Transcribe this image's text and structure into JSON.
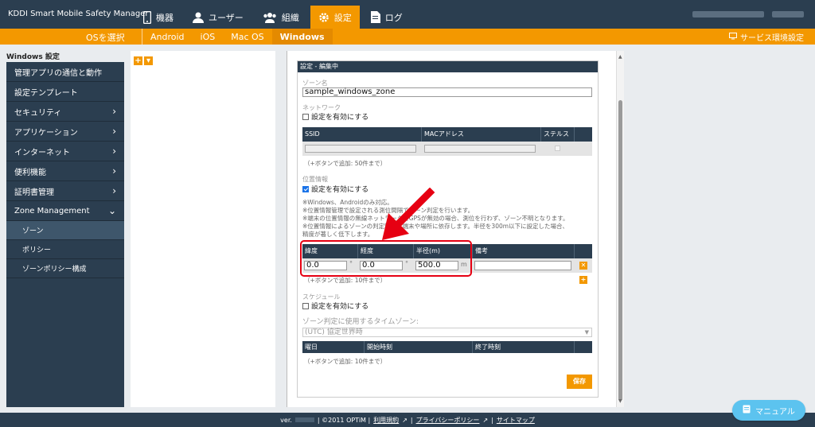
{
  "header": {
    "brand": "KDDI Smart Mobile Safety Manager",
    "nav": [
      {
        "label": "機器",
        "icon": "phone-icon"
      },
      {
        "label": "ユーザー",
        "icon": "user-icon"
      },
      {
        "label": "組織",
        "icon": "group-icon"
      },
      {
        "label": "設定",
        "icon": "gear-icon",
        "active": true
      },
      {
        "label": "ログ",
        "icon": "document-icon"
      }
    ]
  },
  "subbar": {
    "os_select": "OSを選択",
    "tabs": [
      "Android",
      "iOS",
      "Mac OS",
      "Windows"
    ],
    "active_tab": "Windows",
    "service_settings": "サービス環境設定"
  },
  "sidebar": {
    "title": "Windows 設定",
    "items": [
      {
        "label": "管理アプリの通信と動作",
        "chevron": ""
      },
      {
        "label": "設定テンプレート",
        "chevron": ""
      },
      {
        "label": "セキュリティ",
        "chevron": "›"
      },
      {
        "label": "アプリケーション",
        "chevron": "›"
      },
      {
        "label": "インターネット",
        "chevron": "›"
      },
      {
        "label": "便利機能",
        "chevron": "›"
      },
      {
        "label": "証明書管理",
        "chevron": "›"
      },
      {
        "label": "Zone Management",
        "chevron": "⌄"
      }
    ],
    "subitems": [
      {
        "label": "ゾーン",
        "active": true
      },
      {
        "label": "ポリシー"
      },
      {
        "label": "ゾーンポリシー構成"
      }
    ]
  },
  "tree": {
    "add_btn": "+",
    "dropdown_btn": "▾"
  },
  "form": {
    "header": "設定 - 編集中",
    "zone_name_label": "ゾーン名",
    "zone_name_value": "sample_windows_zone",
    "network_label": "ネットワーク",
    "network_enable": "設定を有効にする",
    "wifi_headers": [
      "SSID",
      "MACアドレス",
      "ステルス"
    ],
    "wifi_note": "（+ボタンで追加: 50件まで）",
    "location_label": "位置情報",
    "location_enable": "設定を有効にする",
    "location_notes": [
      "※Windows、Androidのみ対応。",
      "※位置情報管理で設定される測位間隔でゾーン判定を行います。",
      "※端末の位置情報の無線ネットワークとGPSが無効の場合、測位を行わず、ゾーン不明となります。",
      "※位置情報によるゾーンの判定精度は端末や場所に依存します。半径を300m以下に設定した場合、",
      "精度が著しく低下します。"
    ],
    "geo_headers": [
      "緯度",
      "経度",
      "半径(m)",
      "備考"
    ],
    "latitude": "0.0",
    "longitude": "0.0",
    "radius": "500.0",
    "unit_deg": "°",
    "unit_m": "m",
    "geo_note": "（+ボタンで追加: 10件まで）",
    "delete_btn": "✕",
    "add_btn": "+",
    "schedule_label": "スケジュール",
    "schedule_enable": "設定を有効にする",
    "timezone_label": "ゾーン判定に使用するタイムゾーン:",
    "timezone_value": "(UTC) 協定世界時",
    "schedule_headers": [
      "曜日",
      "開始時刻",
      "終了時刻"
    ],
    "schedule_note": "（+ボタンで追加: 10件まで）",
    "save": "保存"
  },
  "footer": {
    "version_prefix": "ver.",
    "copyright": "| ©2011 OPTiM |",
    "terms": "利用規約",
    "privacy": "プライバシーポリシー",
    "sitemap": "サイトマップ",
    "sep": "|"
  },
  "manual_btn": "マニュアル",
  "colors": {
    "navy": "#2b3e50",
    "orange": "#f39800",
    "annotation_red": "#e60012"
  }
}
